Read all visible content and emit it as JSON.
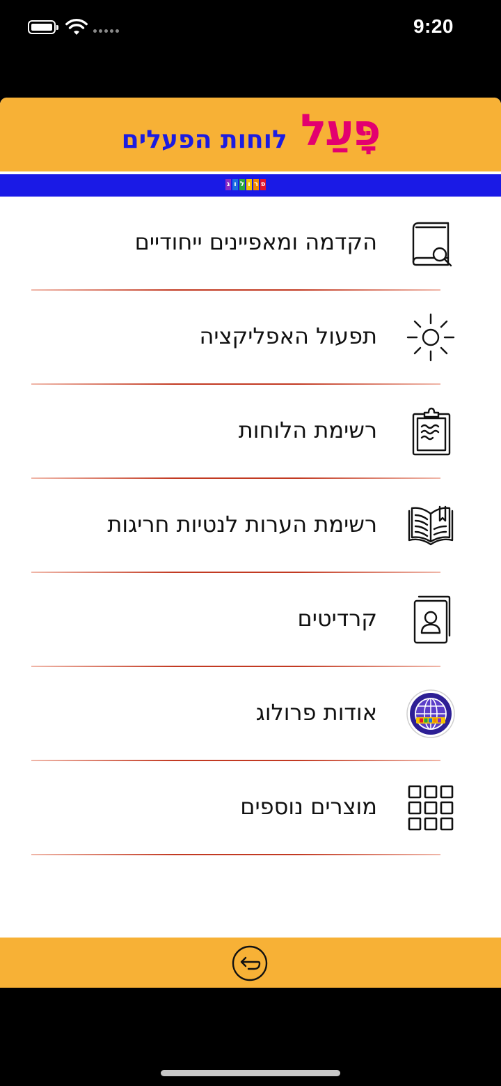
{
  "status_bar": {
    "time": "9:20"
  },
  "header": {
    "logo_main": "פָּעַל",
    "logo_sub": "לוחות הפעלים",
    "brand_letters": [
      "פ",
      "ר",
      "ו",
      "ל",
      "ו",
      "ג"
    ],
    "brand_colors": [
      "#e3142b",
      "#f08a00",
      "#f2c200",
      "#2aa63c",
      "#1c6ee0",
      "#8b2bc2"
    ]
  },
  "menu": {
    "items": [
      {
        "label": "הקדמה ומאפיינים ייחודיים",
        "icon": "book-search-icon"
      },
      {
        "label": "תפעול האפליקציה",
        "icon": "sun-icon"
      },
      {
        "label": "רשימת הלוחות",
        "icon": "clipboard-icon"
      },
      {
        "label": "רשימת הערות לנטיות חריגות",
        "icon": "open-book-icon"
      },
      {
        "label": "קרדיטים",
        "icon": "contact-book-icon"
      },
      {
        "label": "אודות פרולוג",
        "icon": "prolog-globe-icon"
      },
      {
        "label": "מוצרים נוספים",
        "icon": "grid-icon"
      }
    ]
  },
  "footer": {
    "back_icon": "back-arrow-icon"
  },
  "colors": {
    "header_bg": "#f7b136",
    "logo_main": "#e3006f",
    "logo_sub": "#1c1ce0",
    "brand_bar": "#1a1ae6",
    "divider": "#c23a22"
  }
}
